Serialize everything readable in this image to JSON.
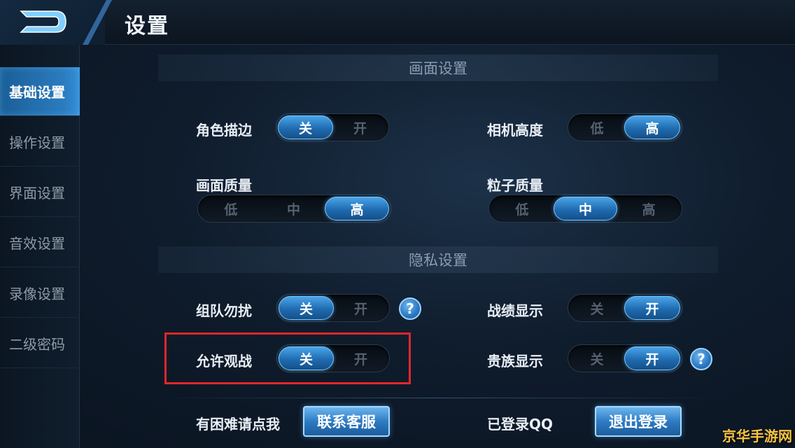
{
  "header": {
    "title": "设置"
  },
  "sidebar": {
    "items": [
      {
        "label": "基础设置",
        "active": true
      },
      {
        "label": "操作设置",
        "active": false
      },
      {
        "label": "界面设置",
        "active": false
      },
      {
        "label": "音效设置",
        "active": false
      },
      {
        "label": "录像设置",
        "active": false
      },
      {
        "label": "二级密码",
        "active": false
      }
    ]
  },
  "sections": {
    "graphics": {
      "title": "画面设置",
      "outline": {
        "label": "角色描边",
        "options": [
          "关",
          "开"
        ],
        "selected": "关"
      },
      "camera": {
        "label": "相机高度",
        "options": [
          "低",
          "高"
        ],
        "selected": "高"
      },
      "quality": {
        "label": "画面质量",
        "options": [
          "低",
          "中",
          "高"
        ],
        "selected": "高"
      },
      "particle": {
        "label": "粒子质量",
        "options": [
          "低",
          "中",
          "高"
        ],
        "selected": "中"
      }
    },
    "privacy": {
      "title": "隐私设置",
      "team_dnd": {
        "label": "组队勿扰",
        "options": [
          "关",
          "开"
        ],
        "selected": "关"
      },
      "record_show": {
        "label": "战绩显示",
        "options": [
          "关",
          "开"
        ],
        "selected": "开"
      },
      "allow_spectate": {
        "label": "允许观战",
        "options": [
          "关",
          "开"
        ],
        "selected": "关"
      },
      "noble_show": {
        "label": "贵族显示",
        "options": [
          "关",
          "开"
        ],
        "selected": "开"
      }
    }
  },
  "footer": {
    "help_text": "有困难请点我",
    "contact_button": "联系客服",
    "login_text": "已登录QQ",
    "logout_button": "退出登录"
  },
  "help_icon_glyph": "?",
  "watermark": "京华手游网",
  "colors": {
    "accent": "#2d7bc4",
    "highlight": "#e3262a",
    "watermark": "#f6c343"
  }
}
